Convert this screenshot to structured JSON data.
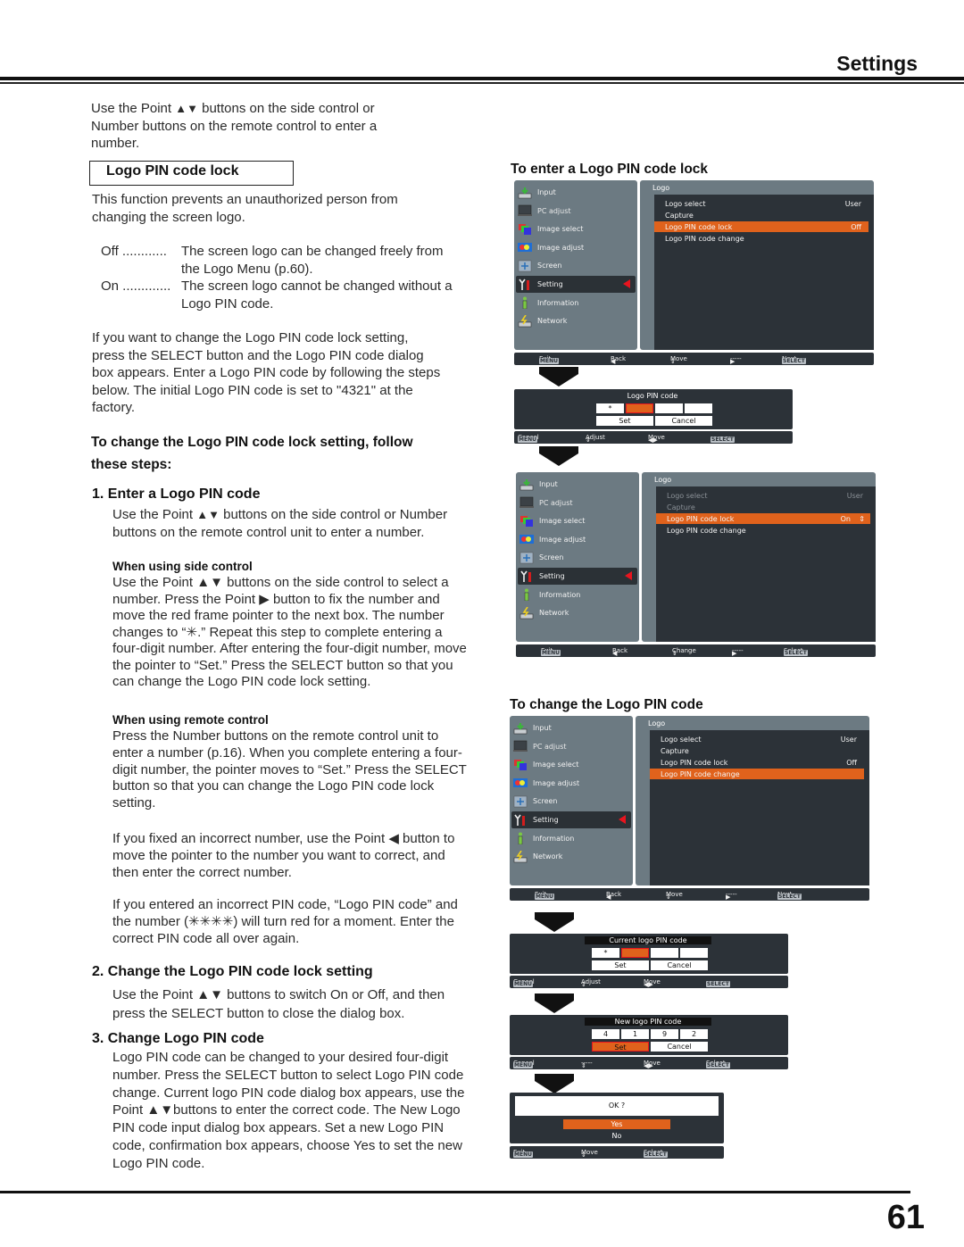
{
  "header": {
    "title": "Settings"
  },
  "footer": {
    "page_number": "61"
  },
  "intro": {
    "line1_pre": "Use the Point ",
    "line1_post": "  buttons on the side control or",
    "line2": "Number buttons on the remote control to enter a",
    "line3": "number."
  },
  "section": {
    "title": "Logo PIN code lock",
    "desc_1": "This function prevents an unauthorized person from",
    "desc_2": "changing the screen logo.",
    "options": [
      {
        "key": "Off ............",
        "val_1": "The screen logo can be changed freely from",
        "val_2": "the Logo Menu (p.60)."
      },
      {
        "key": "On .............",
        "val_1": "The screen logo cannot be changed without a",
        "val_2": "Logo PIN code."
      }
    ],
    "para": [
      "If you want to change the Logo PIN code lock setting,",
      "press the SELECT button and the Logo PIN code dialog",
      "box appears. Enter a Logo PIN code by following the steps",
      "below. The initial Logo PIN code is set to \"4321\" at the",
      "factory."
    ],
    "steps_heading_1": "To change the Logo PIN code lock setting, follow",
    "steps_heading_2": "these steps:"
  },
  "step1": {
    "heading": "1.  Enter a Logo PIN code",
    "body_1_pre": "Use the Point ",
    "body_1_post": " buttons on the side control or Number",
    "body_2": "buttons on the remote control unit to enter a number.",
    "side_title": "When using side control",
    "side_lines": [
      "Use the Point ▲▼ buttons on the side control to select a",
      "number. Press the Point ▶ button to fix the number and",
      "move the red frame pointer to the next box. The number",
      "changes to “✳.” Repeat this step to complete entering a",
      "four-digit number. After entering the four-digit number, move",
      "the pointer to “Set.” Press the SELECT button so that you",
      "can change the Logo PIN code lock setting."
    ],
    "remote_title": "When using remote control",
    "remote_lines": [
      "Press the Number buttons on the remote control unit to",
      "enter a number (p.16). When you complete entering a four-",
      "digit number, the pointer moves to “Set.” Press the SELECT",
      "button so that you can change the Logo PIN code lock",
      "setting."
    ],
    "fix_lines": [
      "If you fixed an incorrect number, use the Point ◀ button to",
      "move the pointer to the number you want to correct, and",
      "then enter the correct number."
    ],
    "wrong_lines": [
      "If you entered an incorrect PIN code, “Logo PIN code” and",
      "the number (✳✳✳✳) will turn red for a moment. Enter the",
      "correct PIN code all over again."
    ]
  },
  "step2": {
    "heading": "2.  Change the Logo PIN code lock setting",
    "lines": [
      "Use the Point ▲▼ buttons to switch On or Off, and then",
      "press the SELECT button to close the dialog box."
    ]
  },
  "step3": {
    "heading": "3.  Change Logo PIN code",
    "lines": [
      "Logo PIN code can be changed to your desired four-digit",
      "number. Press the SELECT button to select Logo PIN code",
      "change. Current logo PIN code dialog box appears, use the",
      "Point ▲▼buttons to enter the correct code. The New Logo",
      "PIN code input dialog box appears. Set a new Logo PIN",
      "code, confirmation box appears, choose Yes to set the new",
      "Logo PIN code."
    ]
  },
  "right": {
    "heading_enter": "To enter a Logo PIN code lock",
    "heading_change": "To change the Logo PIN code"
  },
  "osd": {
    "menu_items": [
      "Input",
      "PC adjust",
      "Image select",
      "Image adjust",
      "Screen",
      "Setting",
      "Information",
      "Network"
    ],
    "submenu_title": "Logo",
    "screen1": {
      "items": [
        {
          "label": "Logo select",
          "value": "User"
        },
        {
          "label": "Capture",
          "value": ""
        },
        {
          "label": "Logo PIN code lock",
          "value": "Off"
        },
        {
          "label": "Logo PIN code change",
          "value": ""
        }
      ],
      "bar": [
        "Exit",
        "Back",
        "Move",
        "-----",
        "Next"
      ]
    },
    "dialog1": {
      "title": "Logo PIN code",
      "digits": [
        "*",
        "",
        "",
        ""
      ],
      "set": "Set",
      "cancel": "Cancel",
      "bar": [
        "Cancel",
        "Adjust",
        "Move",
        "-----"
      ]
    },
    "screen2": {
      "items": [
        {
          "label": "Logo select",
          "value": "User"
        },
        {
          "label": "Capture",
          "value": ""
        },
        {
          "label": "Logo PIN code lock",
          "value": "On"
        },
        {
          "label": "Logo PIN code change",
          "value": ""
        }
      ],
      "bar": [
        "Exit",
        "Back",
        "Change",
        "-----",
        "Select"
      ]
    },
    "screen3": {
      "items": [
        {
          "label": "Logo select",
          "value": "User"
        },
        {
          "label": "Capture",
          "value": ""
        },
        {
          "label": "Logo PIN code lock",
          "value": "Off"
        },
        {
          "label": "Logo PIN code change",
          "value": ""
        }
      ],
      "bar": [
        "Exit",
        "Back",
        "Move",
        "-----",
        "Next"
      ]
    },
    "dialog2": {
      "title": "Current logo PIN code",
      "digits": [
        "*",
        "",
        "",
        ""
      ],
      "set": "Set",
      "cancel": "Cancel",
      "bar": [
        "Cancel",
        "Adjust",
        "Move",
        "-----"
      ]
    },
    "dialog3": {
      "title": "New logo PIN code",
      "digits": [
        "4",
        "1",
        "9",
        "2"
      ],
      "set": "Set",
      "cancel": "Cancel",
      "bar": [
        "Cancel",
        "-----",
        "Move",
        "Select"
      ]
    },
    "dialog4": {
      "question": "OK ?",
      "yes": "Yes",
      "no": "No",
      "bar": [
        "Exit",
        "Move",
        "Select"
      ]
    },
    "keys": {
      "menu": "MENU",
      "select": "SELECT"
    }
  },
  "colors": {
    "highlight": "#e0621c",
    "pointer": "#e8141e",
    "panel": "#6c7a82",
    "dark": "#2c3238"
  }
}
